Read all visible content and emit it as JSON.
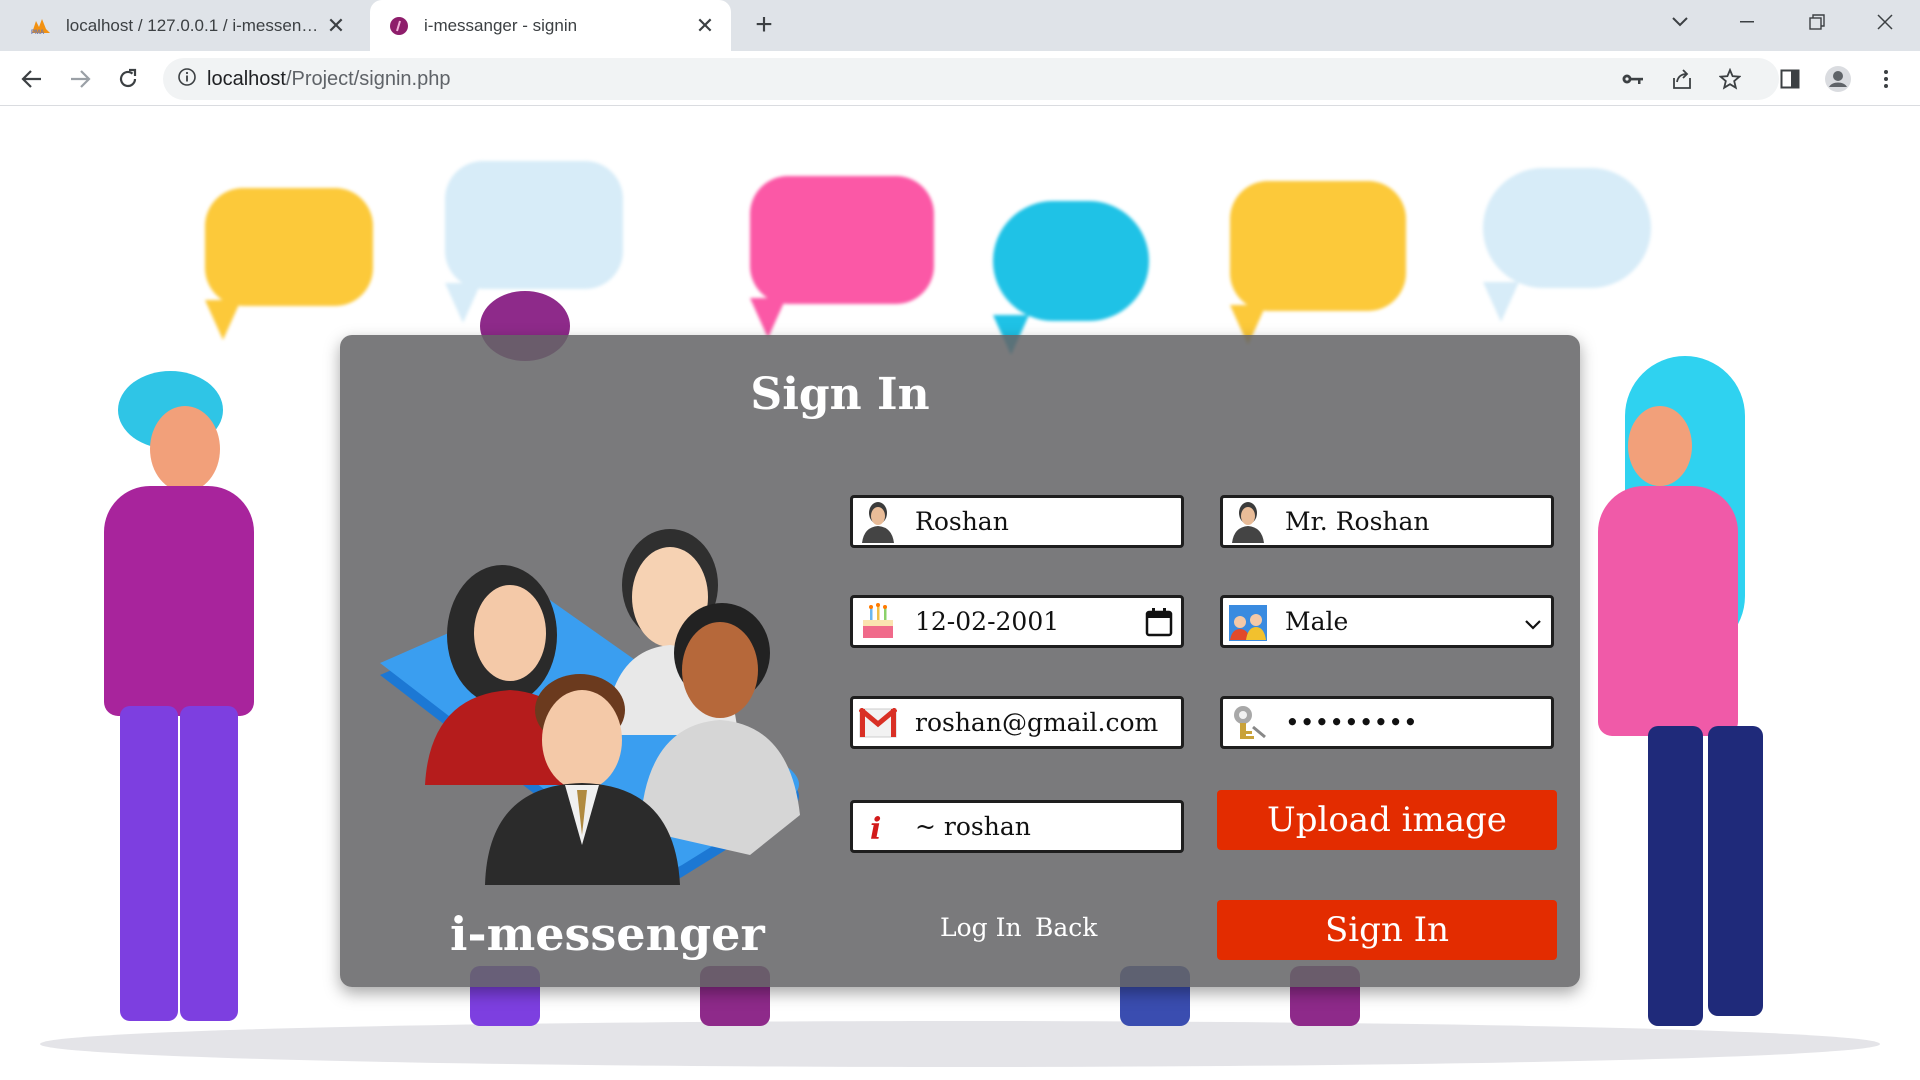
{
  "browser": {
    "tabs": [
      {
        "title": "localhost / 127.0.0.1 / i-messenger",
        "favicon": "phpmyadmin-icon",
        "active": false
      },
      {
        "title": "i-messanger - signin",
        "favicon": "messenger-icon",
        "active": true
      }
    ],
    "url_host": "localhost",
    "url_path": "/Project/signin.php"
  },
  "form": {
    "title": "Sign In",
    "brand": "i-messenger",
    "fields": {
      "first_name": "Roshan",
      "username": "Mr. Roshan",
      "dob": "12-02-2001",
      "gender": "Male",
      "email": "roshan@gmail.com",
      "password": "•••••••••",
      "bio": "~ roshan"
    },
    "upload_label": "Upload image",
    "submit_label": "Sign In",
    "login_link": "Log In",
    "back_link": "Back"
  },
  "colors": {
    "accent_red": "#e32c00",
    "card_bg": "#646466"
  }
}
